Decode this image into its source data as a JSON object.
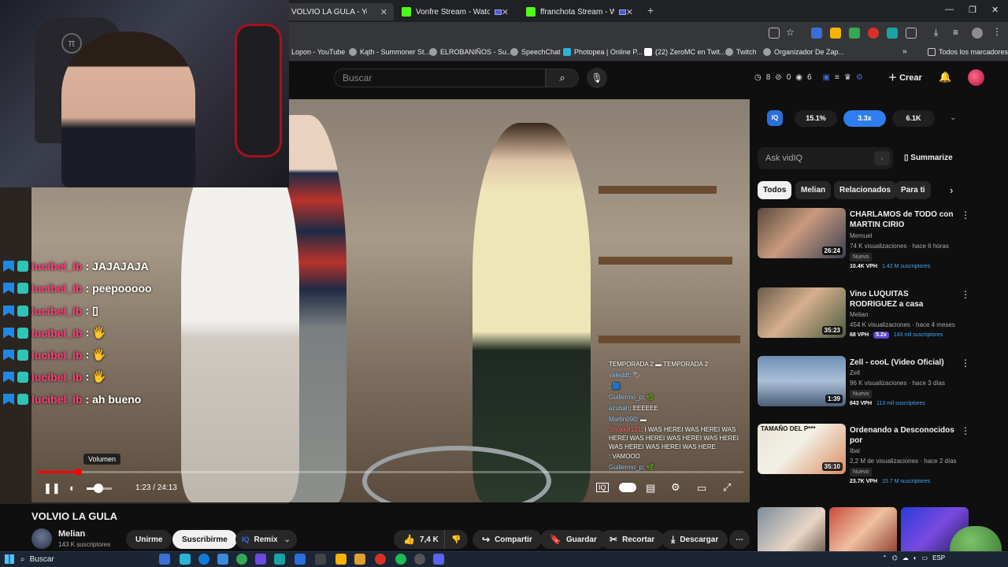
{
  "browser": {
    "tabs": [
      {
        "label": "VOLVIO LA GULA - YouTub",
        "fav": "#ff0000",
        "active": true
      },
      {
        "label": "Vonfre Stream - Watch Live",
        "fav": "#53fc18",
        "active": false
      },
      {
        "label": "ffranchota Stream - Watch",
        "fav": "#53fc18",
        "active": false
      }
    ],
    "bookmarks": [
      "Lopon - YouTube",
      "Kąth - Summoner St...",
      "ELROBANIÑOS - Su...",
      "SpeechChat",
      "Photopea | Online P...",
      "(22) ZeroMC en Twit...",
      "Twitch",
      "Organizador De Zap..."
    ],
    "bookmarks_right": "Todos los marcadores"
  },
  "header": {
    "search_placeholder": "Buscar",
    "stats": [
      "8",
      "0",
      "6"
    ],
    "create_label": "Crear"
  },
  "left_chat": [
    {
      "user": "lucibel_ib",
      "text": ": JAJAJAJA"
    },
    {
      "user": "lucibel_ib",
      "text": ": peepooooo"
    },
    {
      "user": "lucibel_ib",
      "text": ": ▯"
    },
    {
      "user": "lucibel_ib",
      "text": ": 🖐"
    },
    {
      "user": "lucibel_ib",
      "text": ": 🖐"
    },
    {
      "user": "lucibel_ib",
      "text": ": 🖐"
    },
    {
      "user": "lucibel_ib",
      "text": ": ah bueno"
    }
  ],
  "player_chat": [
    {
      "user": "",
      "text": "TEMPORADA 2 ▬ TEMPORADA 2",
      "cls": ""
    },
    {
      "user": "valeddt",
      "text": ": 🏷",
      "cls": "u"
    },
    {
      "user": "",
      "text": ": 🟦",
      "cls": "r"
    },
    {
      "user": "Guillermo_p",
      "text": ": 🌿",
      "cls": "u"
    },
    {
      "user": "azubah",
      "text": ": EEEEEE",
      "cls": "u"
    },
    {
      "user": "Martin090",
      "text": ": ▬",
      "cls": "u"
    },
    {
      "user": "Shokkill121",
      "text": ": I WAS HEREI WAS HEREI WAS HEREI WAS HEREI WAS HEREI WAS HEREI WAS HEREI WAS HEREI WAS HERE",
      "cls": "r"
    },
    {
      "user": "",
      "text": ": VAMOOO",
      "cls": "r"
    },
    {
      "user": "Guillermo_p",
      "text": ": 🌿",
      "cls": "u"
    }
  ],
  "player": {
    "volume_tooltip": "Volumen",
    "time": "1:23 / 24:13",
    "progress": 0.057,
    "volume": 0.35
  },
  "video": {
    "title": "VOLVIO LA GULA",
    "channel": "Melian",
    "subscribers": "143 K suscriptores",
    "join_label": "Unirme",
    "subscribe_label": "Suscribirme",
    "remix_label": "Remix",
    "likes": "7,4 K",
    "share_label": "Compartir",
    "save_label": "Guardar",
    "clip_label": "Recortar",
    "download_label": "Descargar"
  },
  "vidiq": {
    "logo": "IQ",
    "stats": [
      "15.1%",
      "3.3x",
      "6.1K"
    ],
    "ask_placeholder": "Ask vidIQ",
    "summarize_label": "Summarize"
  },
  "chips": [
    "Todos",
    "Melian",
    "Relacionados",
    "Para ti"
  ],
  "recommendations": [
    {
      "title": "CHARLAMOS de TODO con MARTIN CIRIO",
      "channel": "Memuel",
      "meta": "74 K visualizaciones · hace 6 horas",
      "badge": "Nuevo",
      "vph": "10.4K VPH",
      "mult": "",
      "subs": "1.42 M suscriptores",
      "duration": "26:24",
      "thumb": "linear-gradient(135deg,#5b4a3e,#c99a7e 45%,#3b3f52)"
    },
    {
      "title": "Vino LUQUITAS RODRIGUEZ a casa",
      "channel": "Melian",
      "meta": "454 K visualizaciones · hace 4 meses",
      "badge": "",
      "vph": "68 VPH",
      "mult": "5.2x",
      "subs": "143 mil suscriptores",
      "duration": "35:23",
      "thumb": "linear-gradient(135deg,#6a5b4b,#d6b08f 45%,#4b5a3f)"
    },
    {
      "title": "Zell - cooL (Video Oficial)",
      "channel": "Zell",
      "meta": "96 K visualizaciones · hace 3 días",
      "badge": "Nuevo",
      "vph": "843 VPH",
      "mult": "",
      "subs": "113 mil suscriptores",
      "duration": "1:39",
      "thumb": "linear-gradient(180deg,#6f8fb5,#a9bfd6 50%,#4a5d78)"
    },
    {
      "title": "Ordenando a Desconocidos por",
      "channel": "Ibai",
      "meta": "2,2 M de visualizaciones · hace 2 días",
      "badge": "Nuevo",
      "vph": "23.7K VPH",
      "mult": "",
      "subs": "15.7 M suscriptores",
      "duration": "35:10",
      "thumb": "linear-gradient(135deg,#e9e4d6,#f3f0e6 45%,#d98c5f)",
      "thumb_text": "TAMAÑO DEL P***"
    }
  ],
  "taskbar": {
    "search_label": "Buscar",
    "tray": "ESP"
  }
}
